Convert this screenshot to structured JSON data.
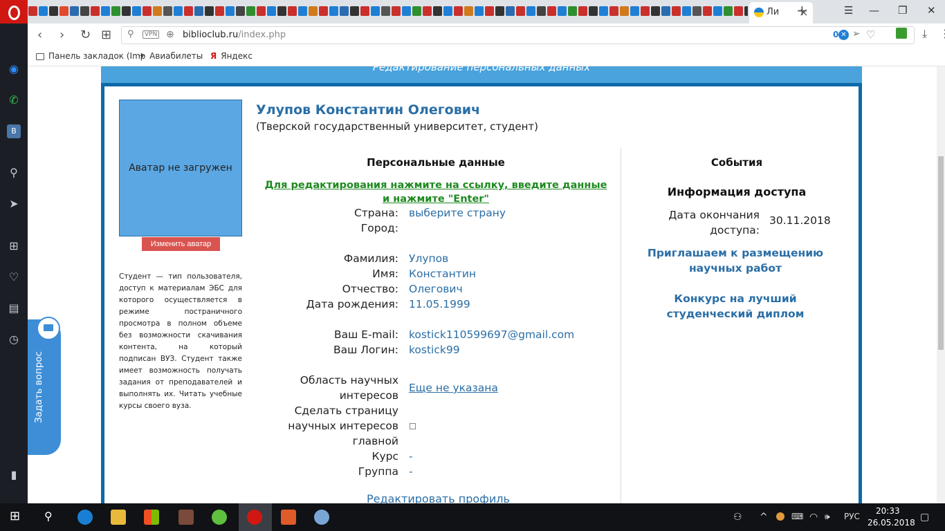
{
  "browser": {
    "active_tab_label": "Ли",
    "tab_close": "×",
    "new_tab": "+",
    "win_minimize": "—",
    "win_restore": "❐",
    "win_close": "✕",
    "url_host": "biblioclub.ru",
    "url_path": "/index.php",
    "vpn_label": "VPN",
    "adblock_count": "0",
    "bookmarks": [
      {
        "label": "Панель закладок (Imp"
      },
      {
        "label": "Авиабилеты"
      },
      {
        "label": "Яндекс"
      }
    ],
    "icons": {
      "back": "‹",
      "forward": "›",
      "reload": "↻",
      "grid": "⊞",
      "key": "⚲",
      "globe": "⊕",
      "send": "➢",
      "heart": "♡",
      "download": "⤓",
      "menu": "⋮"
    },
    "tab_favicon_colors": [
      "#c9302c",
      "#1e7fd5",
      "#333",
      "#e04b2c",
      "#2b6cb0",
      "#444",
      "#c9302c",
      "#1e7fd5",
      "#2f8f2f",
      "#333",
      "#1e7fd5",
      "#c9302c",
      "#d07a1c",
      "#555",
      "#1e7fd5",
      "#c9302c",
      "#2b6cb0",
      "#333",
      "#c9302c",
      "#1e7fd5",
      "#444",
      "#2f8f2f",
      "#c9302c",
      "#1e7fd5",
      "#333",
      "#c9302c",
      "#1e7fd5",
      "#d07a1c",
      "#c9302c",
      "#1e7fd5",
      "#2b6cb0",
      "#333",
      "#c9302c",
      "#1e7fd5",
      "#555",
      "#c9302c",
      "#1e7fd5",
      "#2f8f2f",
      "#c9302c",
      "#333",
      "#1e7fd5",
      "#c9302c",
      "#d07a1c",
      "#1e7fd5",
      "#c9302c",
      "#333",
      "#2b6cb0",
      "#c9302c",
      "#1e7fd5",
      "#444",
      "#c9302c",
      "#1e7fd5",
      "#2f8f2f",
      "#c9302c",
      "#333",
      "#1e7fd5",
      "#c9302c",
      "#d07a1c",
      "#1e7fd5",
      "#c9302c",
      "#333",
      "#2b6cb0",
      "#c9302c",
      "#1e7fd5",
      "#555",
      "#c9302c",
      "#1e7fd5",
      "#2f8f2f",
      "#c9302c",
      "#333"
    ]
  },
  "sidebar": {
    "icons": {
      "messenger": "◉",
      "whatsapp": "✆",
      "vk": "В",
      "search": "⚲",
      "send": "➤",
      "speed_dial": "⊞",
      "heart": "♡",
      "news": "▤",
      "history": "◷",
      "panel": "▮"
    }
  },
  "page": {
    "frame_title": "Редактирование персональных данных",
    "avatar_placeholder": "Аватар не загружен",
    "change_avatar_label": "Изменить аватар",
    "student_description": "Студент — тип пользователя, доступ к материалам ЭБС для которого осуществляется в режиме постраничного просмотра в полном объеме без возможности скачивания контента, на который подписан ВУЗ. Студент также имеет возможность получать задания от преподавателей и выполнять их. Читать учебные курсы своего вуза.",
    "user_name": "Улупов Константин Олегович",
    "user_org": "(Тверской государственный университет, студент)",
    "personal_title": "Персональные данные",
    "edit_hint": "Для редактирования нажмите на ссылку, введите данные и нажмите \"Enter\"",
    "fields": {
      "country_label": "Страна:",
      "country_value": "выберите страну",
      "city_label": "Город:",
      "surname_label": "Фамилия:",
      "surname_value": "Улупов",
      "name_label": "Имя:",
      "name_value": "Константин",
      "patronymic_label": "Отчество:",
      "patronymic_value": "Олегович",
      "birth_label": "Дата рождения:",
      "birth_value": "11.05.1999",
      "email_label": "Ваш E-mail:",
      "email_value": "kostick110599697@gmail.com",
      "login_label": "Ваш Логин:",
      "login_value": "kostick99",
      "interests_label": "Область научных интересов",
      "interests_value": "Еще не указана",
      "make_main_label": "Сделать страницу научных интересов главной",
      "course_label": "Курс",
      "course_value": "-",
      "group_label": "Группа",
      "group_value": "-"
    },
    "edit_profile_link": "Редактировать профиль",
    "events_title": "События",
    "access_title": "Информация доступа",
    "access_end_label": "Дата окончания доступа:",
    "access_end_value": "30.11.2018",
    "invite_link": "Приглашаем к размещению научных работ",
    "contest_link": "Конкурс на лучший студенческий диплом",
    "ask_question": "Задать вопрос"
  },
  "taskbar": {
    "language": "РУС",
    "time": "20:33",
    "date": "26.05.2018",
    "icons": {
      "start": "⊞",
      "search": "⚲",
      "people": "⚇",
      "chevron": "^",
      "wifi": "◠",
      "volume": "🕪",
      "notifications": "▢"
    }
  }
}
